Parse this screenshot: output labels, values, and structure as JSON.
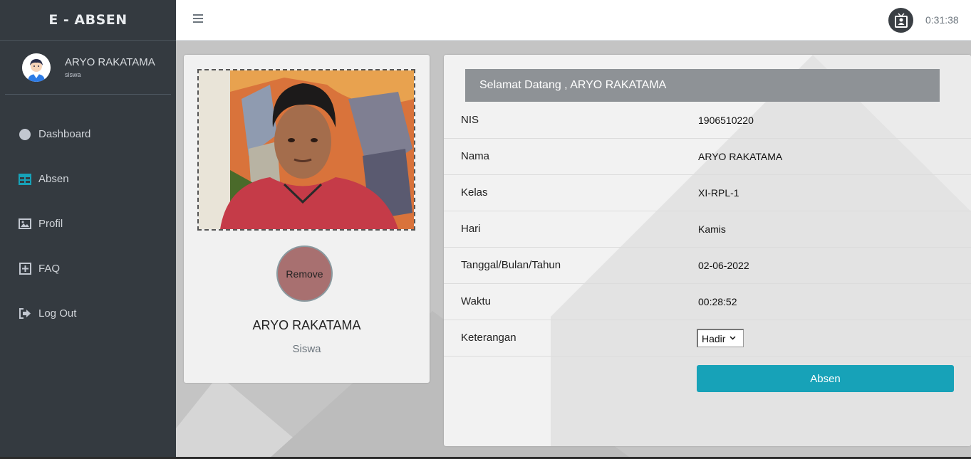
{
  "brand": "E - ABSEN",
  "user": {
    "name": "ARYO RAKATAMA",
    "role": "siswa"
  },
  "nav": [
    {
      "label": "Dashboard",
      "icon": "circle-icon"
    },
    {
      "label": "Absen",
      "icon": "table-icon"
    },
    {
      "label": "Profil",
      "icon": "image-icon"
    },
    {
      "label": "FAQ",
      "icon": "plus-square-icon"
    },
    {
      "label": "Log Out",
      "icon": "sign-out-icon"
    }
  ],
  "topbar": {
    "clock": "0:31:38",
    "icon": "id-badge-icon"
  },
  "profile": {
    "remove_label": "Remove",
    "name": "ARYO RAKATAMA",
    "role": "Siswa"
  },
  "welcome": "Selamat Datang ,  ARYO RAKATAMA",
  "rows": [
    {
      "key": "NIS",
      "value": "1906510220"
    },
    {
      "key": "Nama",
      "value": "ARYO RAKATAMA"
    },
    {
      "key": "Kelas",
      "value": "XI-RPL-1"
    },
    {
      "key": "Hari",
      "value": "Kamis"
    },
    {
      "key": "Tanggal/Bulan/Tahun",
      "value": "02-06-2022"
    },
    {
      "key": "Waktu",
      "value": "00:28:52"
    }
  ],
  "keterangan": {
    "label": "Keterangan",
    "selected": "Hadir"
  },
  "absen_button": "Absen",
  "colors": {
    "sidebar": "#343a40",
    "accent": "#17a2b8",
    "remove": "#a87070",
    "welcome_bar": "#8e9296"
  }
}
